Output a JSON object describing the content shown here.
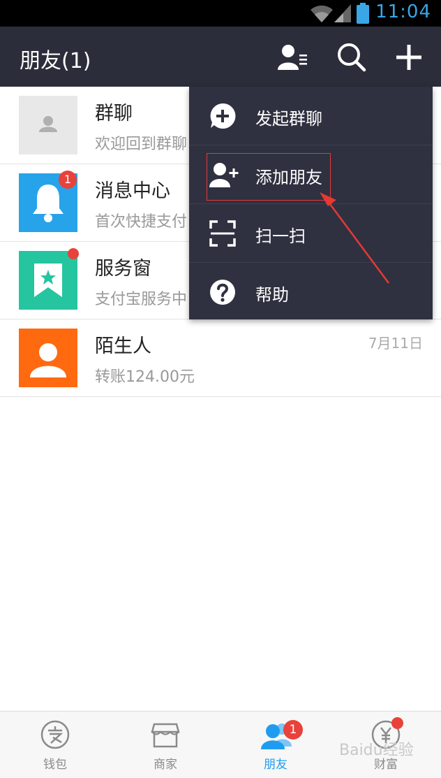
{
  "status_bar": {
    "time": "11:04",
    "icons": [
      "wifi-icon",
      "cell-signal-icon",
      "battery-icon"
    ]
  },
  "header": {
    "title": "朋友(1)",
    "icons": [
      "contacts-icon",
      "search-icon",
      "add-icon"
    ]
  },
  "conversations": [
    {
      "name": "群聊",
      "preview": "欢迎回到群聊",
      "time": "",
      "icon": "person-placeholder-icon",
      "avatar_color": "#e8e8e8"
    },
    {
      "name": "消息中心",
      "preview": "首次快捷支付",
      "time": "",
      "badge": "1",
      "icon": "bell-icon",
      "avatar_color": "#27a3ea"
    },
    {
      "name": "服务窗",
      "preview": "支付宝服务中",
      "time": "",
      "dot": true,
      "icon": "bookmark-star-icon",
      "avatar_color": "#25c5a0"
    },
    {
      "name": "陌生人",
      "preview": "转账124.00元",
      "time": "7月11日",
      "icon": "person-icon",
      "avatar_color": "#ff6a10"
    }
  ],
  "menu": {
    "items": [
      {
        "label": "发起群聊",
        "icon": "chat-plus-icon"
      },
      {
        "label": "添加朋友",
        "icon": "add-friend-icon"
      },
      {
        "label": "扫一扫",
        "icon": "scan-icon"
      },
      {
        "label": "帮助",
        "icon": "help-icon"
      }
    ],
    "highlighted": "添加朋友"
  },
  "tab_bar": {
    "tabs": [
      {
        "label": "钱包",
        "icon": "wallet-icon",
        "active": false
      },
      {
        "label": "商家",
        "icon": "store-icon",
        "active": false
      },
      {
        "label": "朋友",
        "icon": "friends-icon",
        "active": true,
        "badge": "1"
      },
      {
        "label": "财富",
        "icon": "wealth-icon",
        "active": false,
        "dot": true
      }
    ]
  },
  "colors": {
    "header_bg": "#2b2d3a",
    "menu_bg": "#2f3140",
    "accent_blue": "#1f9cf0",
    "badge_red": "#e8423b"
  },
  "watermark": "Baidu经验"
}
